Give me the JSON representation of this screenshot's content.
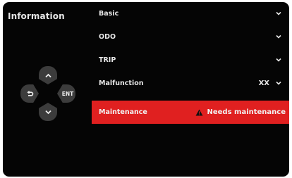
{
  "sidebar": {
    "title": "Information"
  },
  "dpad": {
    "up": "up",
    "down": "down",
    "back": "back",
    "enter_label": "ENT"
  },
  "menu": {
    "items": [
      {
        "label": "Basic"
      },
      {
        "label": "ODO"
      },
      {
        "label": "TRIP"
      },
      {
        "label": "Malfunction",
        "value": "XX"
      },
      {
        "label": "Maintenance",
        "status": "Needs maintenance"
      }
    ]
  },
  "colors": {
    "background": "#050505",
    "highlight": "#e02020",
    "pad": "#3c3c3c",
    "text": "#e8e8e8"
  }
}
